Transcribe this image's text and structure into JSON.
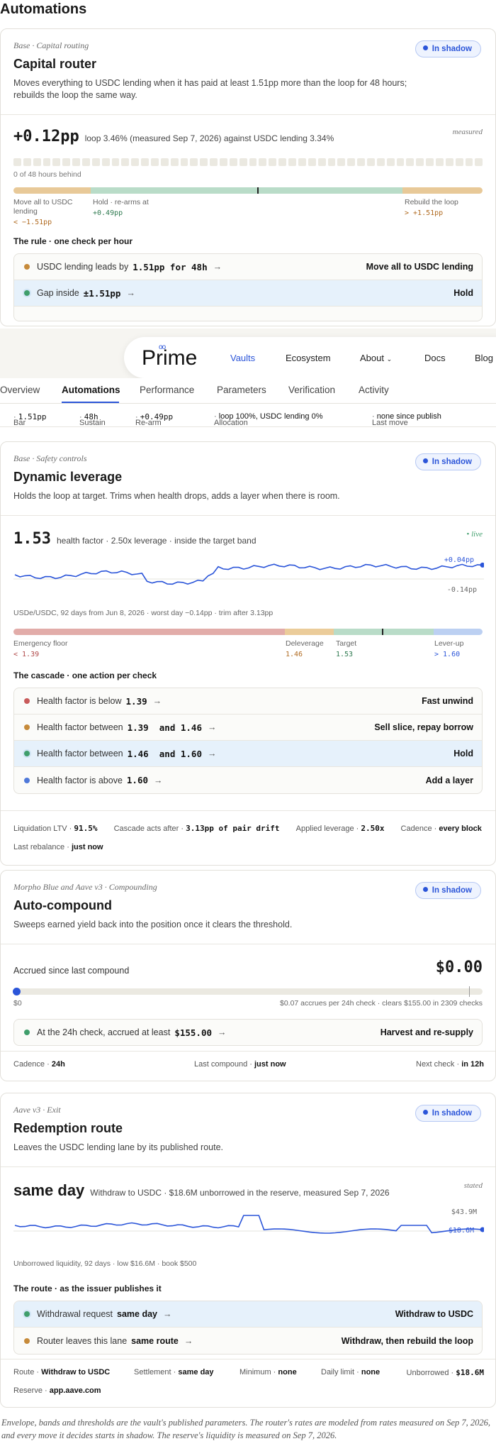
{
  "page": {
    "title": "Automations"
  },
  "nav": {
    "logo": "Prime",
    "links": [
      "Vaults",
      "Ecosystem",
      "About",
      "Docs",
      "Blog"
    ],
    "tabs": [
      "Overview",
      "Automations",
      "Performance",
      "Parameters",
      "Verification",
      "Activity"
    ]
  },
  "capital": {
    "eyebrow": "Base · Capital routing",
    "title": "Capital router",
    "desc": "Moves everything to USDC lending when it has paid at least 1.51pp more than the loop for 48 hours; rebuilds the loop the same way.",
    "badge": "In shadow",
    "metric": "+0.12pp",
    "metric_sub": "loop 3.46% (measured Sep 7, 2026) against USDC lending 3.34%",
    "metric_tag": "measured",
    "hours_note": "0 of 48 hours behind",
    "hours_total": 48,
    "hours_filled": 0,
    "marker_fraction": 0.52,
    "band_left_label": "Move all to USDC lending",
    "band_left_value": "< −1.51pp",
    "band_mid_label": "Hold · re-arms at",
    "band_mid_value": "+0.49pp",
    "band_right_label": "Rebuild the loop",
    "band_right_value": "> +1.51pp",
    "rule_title": "The rule · one check per hour",
    "rules": [
      {
        "cond": "USDC lending leads by",
        "val": "1.51pp for 48h",
        "action": "Move all to USDC lending"
      },
      {
        "cond": "Gap inside",
        "val": "±1.51pp",
        "action": "Hold"
      }
    ],
    "strip": [
      {
        "k": "Bar",
        "v": "1.51pp"
      },
      {
        "k": "Sustain",
        "v": "48h"
      },
      {
        "k": "Re-arm",
        "v": "+0.49pp"
      },
      {
        "k": "Allocation",
        "v": "loop 100%, USDC lending 0%"
      },
      {
        "k": "Last move",
        "v": "none since publish"
      }
    ]
  },
  "leverage": {
    "eyebrow": "Base · Safety controls",
    "title": "Dynamic leverage",
    "desc": "Holds the loop at target. Trims when health drops, adds a layer when there is room.",
    "badge": "In shadow",
    "metric": "1.53",
    "metric_sub": "health factor · 2.50x leverage · inside the target band",
    "metric_tag": "live",
    "chart_top_label": "+0.04pp",
    "chart_bottom_label": "-0.14pp",
    "chart_caption": "USDe/USDC, 92 days from Jun 8, 2026 · worst day −0.14pp · trim after 3.13pp",
    "band_labels": [
      {
        "label": "Emergency floor",
        "value": "< 1.39"
      },
      {
        "label": "Deleverage",
        "value": "1.46"
      },
      {
        "label": "Target",
        "value": "1.53"
      },
      {
        "label": "Lever-up",
        "value": "> 1.60"
      }
    ],
    "marker_value": 1.53,
    "rule_title": "The cascade · one action per check",
    "rules": [
      {
        "cond": "Health factor is below",
        "val": "1.39",
        "action": "Fast unwind"
      },
      {
        "cond": "Health factor between",
        "val": "1.39  and 1.46",
        "action": "Sell slice, repay borrow"
      },
      {
        "cond": "Health factor between",
        "val": "1.46  and 1.60",
        "action": "Hold"
      },
      {
        "cond": "Health factor is above",
        "val": "1.60",
        "action": "Add a layer"
      }
    ],
    "footer": [
      {
        "k": "Liquidation LTV",
        "v": "91.5%"
      },
      {
        "k": "Cascade acts after",
        "v": "3.13pp of pair drift"
      },
      {
        "k": "Applied leverage",
        "v": "2.50x"
      },
      {
        "k": "Cadence",
        "v": "every block"
      },
      {
        "k": "Last rebalance",
        "v": "just now"
      }
    ]
  },
  "compound": {
    "eyebrow": "Morpho Blue and Aave v3 · Compounding",
    "title": "Auto-compound",
    "desc": "Sweeps earned yield back into the position once it clears the threshold.",
    "badge": "In shadow",
    "accrued_label": "Accrued since last compound",
    "accrued_value": "$0.00",
    "progress_fraction": 0.0,
    "progress_left": "$0",
    "progress_right": "$0.07 accrues per 24h check · clears $155.00 in 2309 checks",
    "rule": {
      "cond": "At the 24h check, accrued at least",
      "val": "$155.00",
      "action": "Harvest and re-supply"
    },
    "footer": [
      {
        "k": "Cadence",
        "v": "24h"
      },
      {
        "k": "Last compound",
        "v": "just now"
      },
      {
        "k": "Next check",
        "v": "in 12h"
      }
    ]
  },
  "redemption": {
    "eyebrow": "Aave v3 · Exit",
    "title": "Redemption route",
    "desc": "Leaves the USDC lending lane by its published route.",
    "badge": "In shadow",
    "metric": "same day",
    "metric_sub": "Withdraw to USDC · $18.6M unborrowed in the reserve, measured Sep 7, 2026",
    "metric_tag": "stated",
    "chart_top_label": "$43.9M",
    "chart_end_label": "$18.6M",
    "chart_caption": "Unborrowed liquidity, 92 days · low $16.6M · book $500",
    "rule_title": "The route · as the issuer publishes it",
    "rules": [
      {
        "cond": "Withdrawal request",
        "val": "same day",
        "action": "Withdraw to USDC"
      },
      {
        "cond": "Router leaves this lane",
        "val": "same route",
        "action": "Withdraw, then rebuild the loop"
      }
    ],
    "footer": [
      {
        "k": "Route",
        "v": "Withdraw to USDC"
      },
      {
        "k": "Settlement",
        "v": "same day"
      },
      {
        "k": "Minimum",
        "v": "none"
      },
      {
        "k": "Daily limit",
        "v": "none"
      },
      {
        "k": "Unborrowed",
        "v": "$18.6M"
      },
      {
        "k": "Reserve",
        "v": "app.aave.com"
      }
    ]
  },
  "footnote": "Envelope, bands and thresholds are the vault's published parameters. The router's rates are modeled from rates measured on Sep 7, 2026, and every move it decides starts in shadow. The reserve's liquidity is measured on Sep 7, 2026.",
  "colors": {
    "accent": "#2b55d9",
    "green": "#3f9e6b",
    "amber": "#c68a3a",
    "red": "#c85b5b"
  }
}
